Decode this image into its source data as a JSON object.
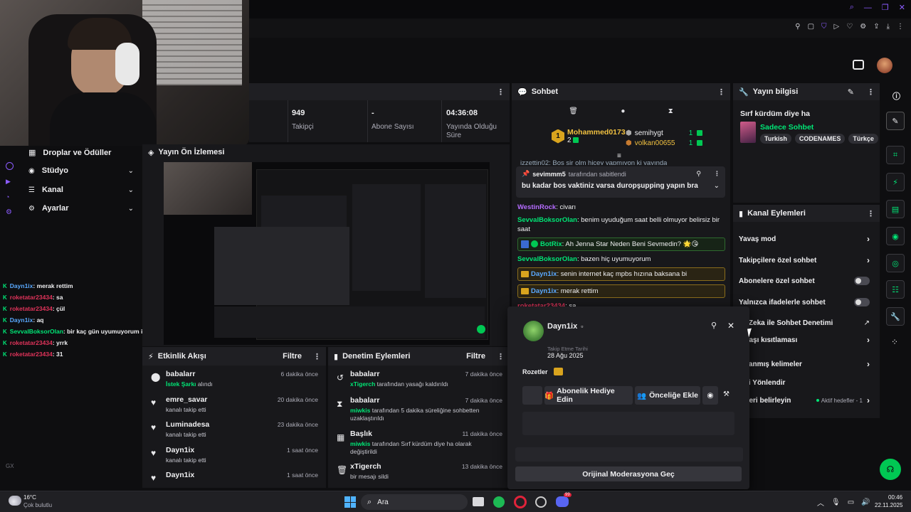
{
  "top_bar": {
    "icons": [
      "pin-icon",
      "screen-icon",
      "shield-icon",
      "play-icon",
      "heart-icon",
      "gear-icon",
      "share-icon",
      "download-icon",
      "more-icon"
    ]
  },
  "stats": {
    "followers": {
      "value": "949",
      "label": "Takipçi"
    },
    "subs": {
      "value": "-",
      "label": "Abone Sayısı"
    },
    "uptime": {
      "value": "04:36:08",
      "label": "Yayında Olduğu Süre"
    }
  },
  "left_nav": {
    "items": [
      {
        "label": "Droplar ve Ödüller"
      },
      {
        "label": "Stüdyo"
      },
      {
        "label": "Kanal"
      },
      {
        "label": "Ayarlar"
      }
    ]
  },
  "preview": {
    "title": "Yayın Ön İzlemesi"
  },
  "left_chat": [
    {
      "user": "Dayn1ix",
      "msg": ": merak rettim",
      "color": "#5aa9ff"
    },
    {
      "user": "roketatar23434",
      "msg": ": sa",
      "color": "#e0335a"
    },
    {
      "user": "roketatar23434",
      "msg": ": çül",
      "color": "#e0335a"
    },
    {
      "user": "Dayn1ix",
      "msg": ": aq",
      "color": "#5aa9ff"
    },
    {
      "user": "SevvalBoksorOlan",
      "msg": ": bir kaç gün uyumuyorum işte nvdovjcns",
      "color": "#00e676"
    },
    {
      "user": "roketatar23434",
      "msg": ": yrrk",
      "color": "#e0335a"
    },
    {
      "user": "roketatar23434",
      "msg": ": 31",
      "color": "#e0335a"
    }
  ],
  "activity": {
    "title": "Etkinlik Akışı",
    "filter": "Filtre",
    "items": [
      {
        "user": "babalarr",
        "detail_hl": "İstek Şarkı",
        "detail": " alındı",
        "time": "6 dakika önce",
        "icon": "song-icon"
      },
      {
        "user": "emre_savar",
        "detail_hl": "",
        "detail": "kanalı takip etti",
        "time": "20 dakika önce",
        "icon": "heart-icon"
      },
      {
        "user": "Luminadesa",
        "detail_hl": "",
        "detail": "kanalı takip etti",
        "time": "23 dakika önce",
        "icon": "heart-icon"
      },
      {
        "user": "Dayn1ix",
        "detail_hl": "",
        "detail": "kanalı takip etti",
        "time": "1 saat önce",
        "icon": "heart-icon"
      },
      {
        "user": "Dayn1ix",
        "detail_hl": "",
        "detail": "",
        "time": "1 saat önce",
        "icon": "heart-icon"
      }
    ]
  },
  "mod_actions": {
    "title": "Denetim Eylemleri",
    "filter": "Filtre",
    "items": [
      {
        "user": "babalarr",
        "actor": "xTigerch",
        "detail": " tarafından yasağı kaldırıldı",
        "detail2": "",
        "time": "7 dakika önce",
        "icon": "undo-icon"
      },
      {
        "user": "babalarr",
        "actor": "miwkis",
        "detail": " tarafından 5 dakika süreliğine sohbetten",
        "detail2": "uzaklaştırıldı",
        "time": "7 dakika önce",
        "icon": "hourglass-icon"
      },
      {
        "user": "Başlık",
        "actor": "miwkis",
        "detail": " tarafından Sırf kürdüm diye ha olarak",
        "detail2": "değiştirildi",
        "time": "11 dakika önce",
        "icon": "title-icon"
      },
      {
        "user": "xTigerch",
        "actor": "",
        "detail": "bir mesajı sildi",
        "detail2": "",
        "time": "13 dakika önce",
        "icon": "trash-icon"
      }
    ]
  },
  "chat": {
    "title": "Sohbet",
    "top": [
      {
        "name": "Mohammed0173",
        "count": "2",
        "rank": "1"
      },
      {
        "name": "semihygt",
        "count": "1"
      },
      {
        "name": "volkan00655",
        "count": "1"
      }
    ],
    "partial": "izzettin02: Boş sir olm hiçey yapmıyon ki yayında",
    "pinned_by": "sevimmm5",
    "pinned_suffix": " tarafından sabitlendi",
    "pinned_msg": "bu kadar bos vaktiniz varsa duropşupping yapın bra",
    "messages": [
      {
        "user": "WestinRock",
        "msg": ": civarı",
        "color": "#b56cff",
        "style": ""
      },
      {
        "user": "SevvalBoksorOlan",
        "msg": ": benim uyuduğum saat belli olmuyor belirsiz bir saat",
        "color": "#00e676",
        "style": ""
      },
      {
        "user": "BotRix",
        "msg": ": Ah Jenna Star Neden Beni Sevmedin? 🌟😘",
        "color": "#00e676",
        "style": "green"
      },
      {
        "user": "SevvalBoksorOlan",
        "msg": ": bazen hiç uyumuyorum",
        "color": "#00e676",
        "style": ""
      },
      {
        "user": "Dayn1ix",
        "msg": ": senin internet kaç mpbs hızına baksana bi",
        "color": "#5aa9ff",
        "style": "gold"
      },
      {
        "user": "Dayn1ix",
        "msg": ": merak rettim",
        "color": "#5aa9ff",
        "style": "gold"
      },
      {
        "user": "roketatar23434",
        "msg": ": sa",
        "color": "#e0335a",
        "style": ""
      }
    ]
  },
  "user_card": {
    "name": "Dayn1ix",
    "follow_label": "Takip Etme Tarihi",
    "follow_date": "28 Ağu 2025",
    "badges_label": "Rozetler",
    "gift_btn": "Abonelik Hediye Edin",
    "vip_btn": "Önceliğe Ekle",
    "mod_btn": "Orijinal Moderasyona Geç"
  },
  "stream_info": {
    "title": "Yayın bilgisi",
    "stream_title": "Sırf kürdüm diye ha",
    "category": "Sadece Sohbet",
    "tags": [
      "Turkish",
      "CODENAMES",
      "Türkçe"
    ]
  },
  "channel_actions": {
    "title": "Kanal Eylemleri",
    "items": [
      {
        "label": "Yavaş mod",
        "type": "arrow"
      },
      {
        "label": "Takipçilere özel sohbet",
        "type": "arrow"
      },
      {
        "label": "Abonelere özel sohbet",
        "type": "toggle"
      },
      {
        "label": "Yalnızca ifadelerle sohbet",
        "type": "toggle"
      },
      {
        "label": "ay Zeka ile Sohbet Denetimi",
        "type": "ext"
      },
      {
        "label": "p yaşı kısıtlaması",
        "type": "arrow"
      },
      {
        "label": "aklanmış kelimeler",
        "type": "arrow"
      },
      {
        "label": "yici Yönlendir",
        "type": "none"
      },
      {
        "label": "lefleri belirleyin",
        "type": "goal",
        "extra": "Aktif hedefler - 1"
      }
    ]
  },
  "taskbar": {
    "temp": "16°C",
    "weather": "Çok bulutlu",
    "search": "Ara",
    "time": "00:46",
    "date": "22.11.2025",
    "badge": "99"
  },
  "left_rail": {
    "gx": "GX"
  },
  "colors": {
    "accent": "#00e676",
    "bg": "#0e0e10",
    "panel": "#18181b",
    "header": "#1f1f23"
  }
}
